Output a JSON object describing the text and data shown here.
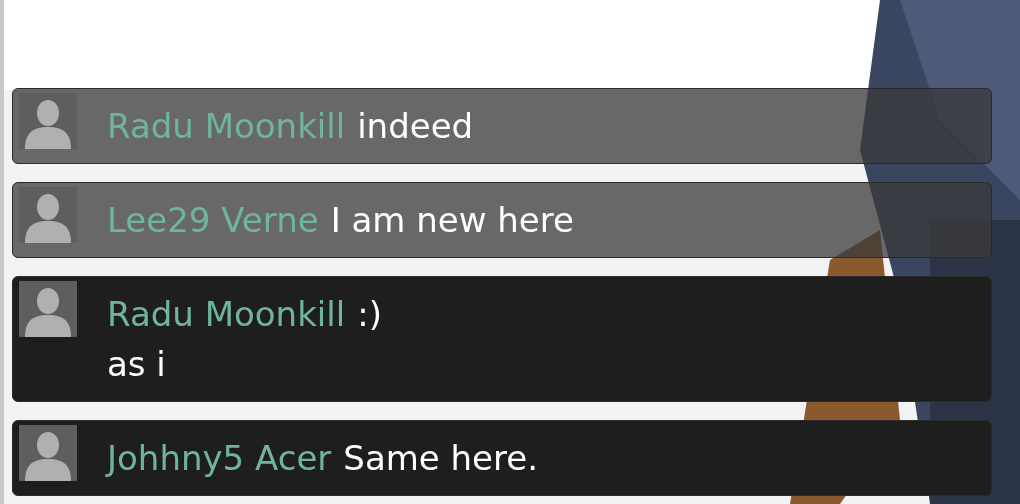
{
  "messages": [
    {
      "name": "Radu Moonkill",
      "lines": [
        "indeed"
      ],
      "faded": true
    },
    {
      "name": "Lee29 Verne",
      "lines": [
        "I am new here"
      ],
      "faded": true
    },
    {
      "name": "Radu Moonkill",
      "lines": [
        ":)",
        "as i"
      ],
      "faded": false
    },
    {
      "name": "Johhny5 Acer",
      "lines": [
        "Same here."
      ],
      "faded": false
    }
  ]
}
